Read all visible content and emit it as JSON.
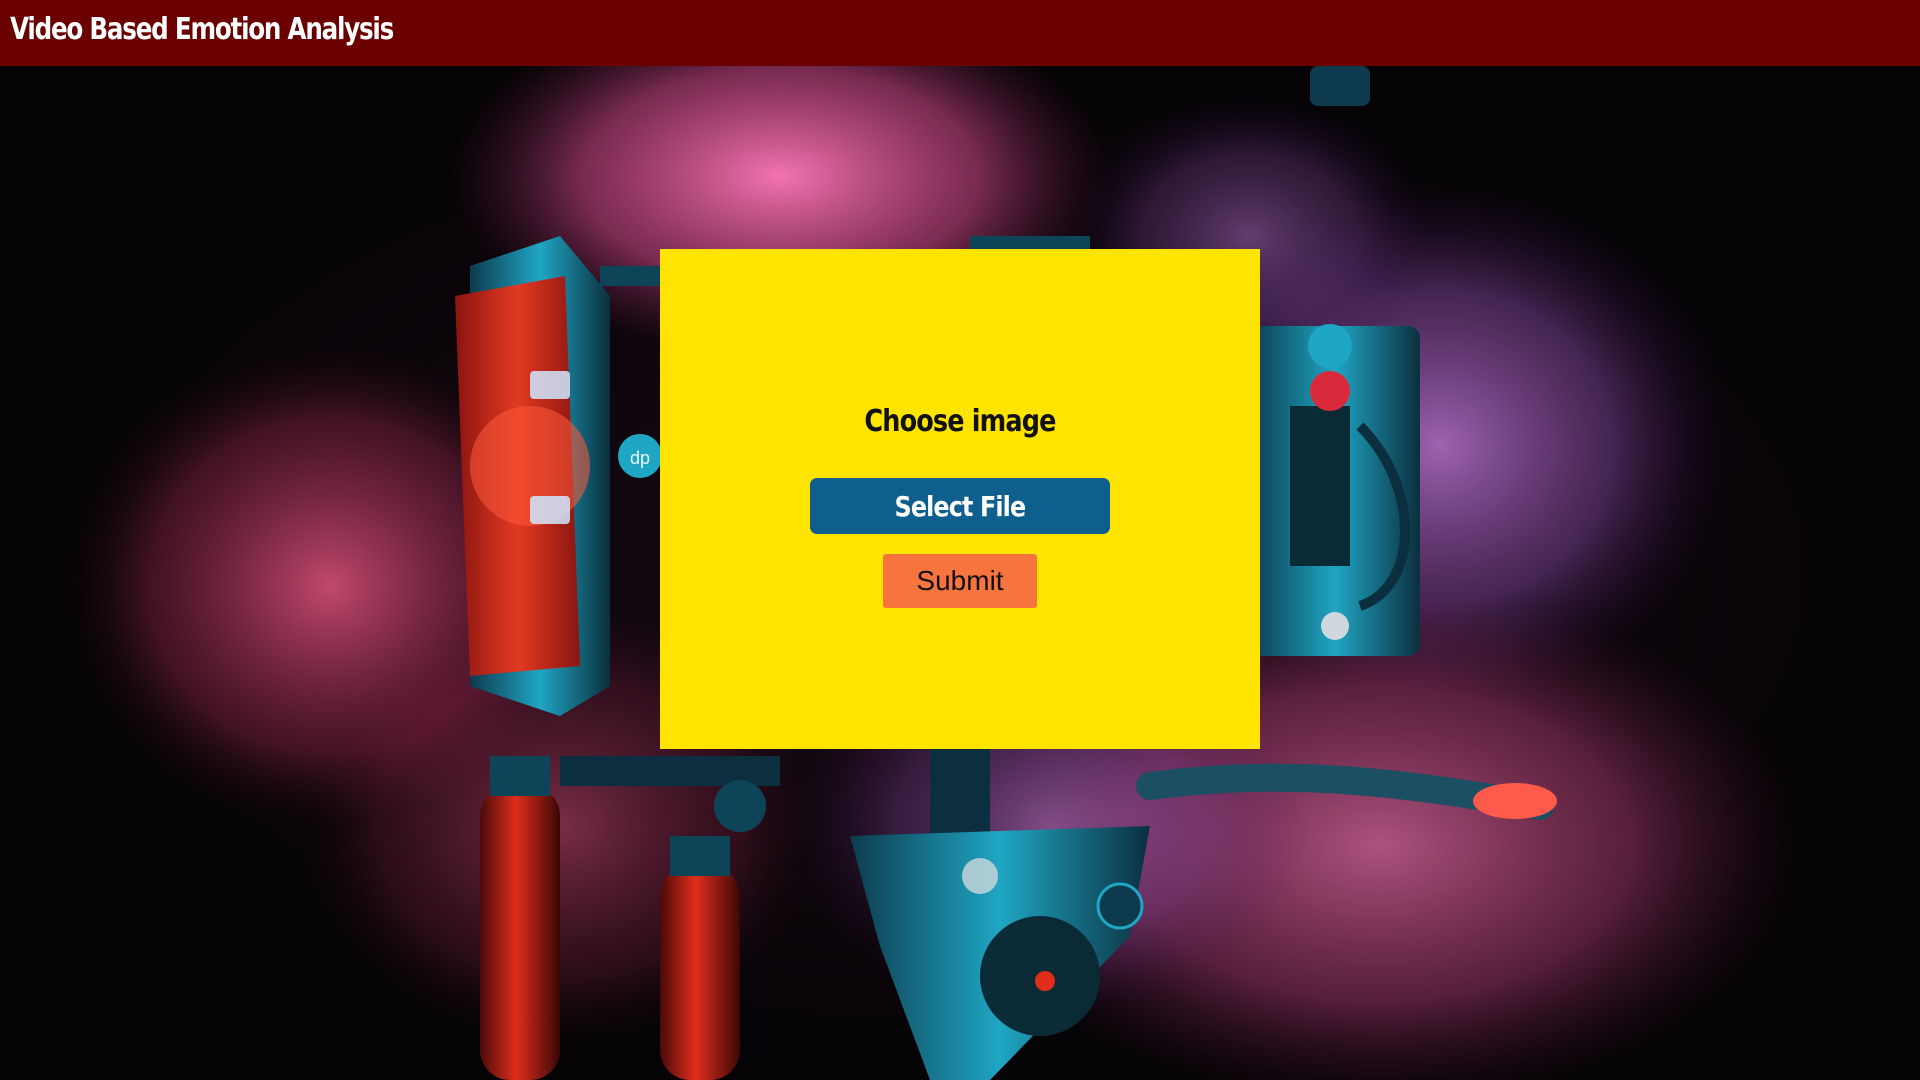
{
  "header": {
    "title": "Video Based Emotion Analysis",
    "background_color": "#6b0000"
  },
  "background": {
    "description_icon": "camera-rig-background-image",
    "dominant_colors": [
      "#050306",
      "#e0508a",
      "#1fa6c4",
      "#d83a2c"
    ]
  },
  "upload_card": {
    "heading": "Choose image",
    "select_button_label": "Select File",
    "submit_button_label": "Submit",
    "card_color": "#ffe400",
    "select_button_color": "#0e5e8e",
    "submit_button_color": "#f7743f"
  }
}
